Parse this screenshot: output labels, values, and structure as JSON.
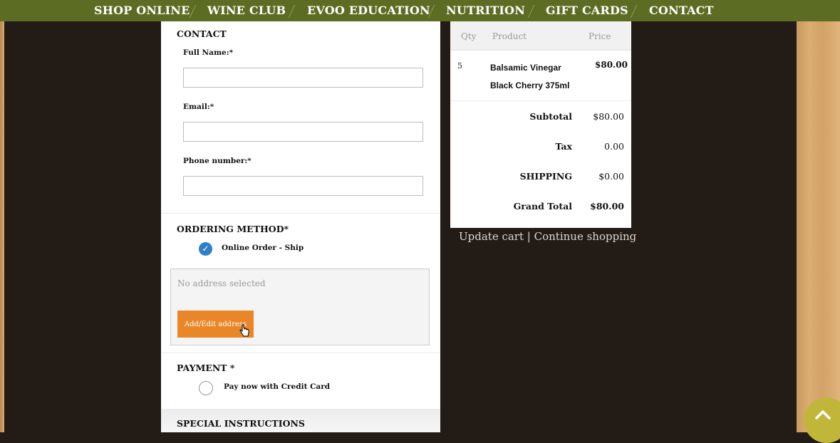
{
  "nav": {
    "items": [
      "SHOP ONLINE",
      "WINE CLUB",
      "EVOO EDUCATION",
      "NUTRITION",
      "GIFT CARDS",
      "CONTACT"
    ]
  },
  "contact": {
    "title": "CONTACT",
    "full_name_label": "Full Name:*",
    "full_name_value": "",
    "email_label": "Email:*",
    "email_value": "",
    "phone_label": "Phone number:*",
    "phone_value": ""
  },
  "ordering": {
    "title": "ORDERING METHOD*",
    "selected_option": "Online Order - Ship",
    "address_placeholder": "No address selected",
    "add_address_label": "Add/Edit address"
  },
  "payment": {
    "title": "PAYMENT *",
    "option": "Pay now with Credit Card"
  },
  "special_instructions": {
    "title": "SPECIAL INSTRUCTIONS"
  },
  "cart": {
    "headers": {
      "qty": "Qty",
      "product": "Product",
      "price": "Price"
    },
    "items": [
      {
        "qty": "5",
        "product_line1": "Balsamic Vinegar",
        "product_line2": "Black Cherry 375ml",
        "price": "$80.00"
      }
    ],
    "subtotal_label": "Subtotal",
    "subtotal_value": "$80.00",
    "tax_label": "Tax",
    "tax_value": "0.00",
    "shipping_label": "SHIPPING",
    "shipping_value": "$0.00",
    "grand_total_label": "Grand Total",
    "grand_total_value": "$80.00"
  },
  "links": {
    "update_cart": "Update cart",
    "separator": "|",
    "continue_shopping": "Continue shopping"
  },
  "colors": {
    "nav_bg": "#5c6d23",
    "page_bg": "#231b16",
    "button_orange": "#e98728",
    "radio_blue": "#2f7fc5",
    "scroll_top": "#c0b63a"
  }
}
